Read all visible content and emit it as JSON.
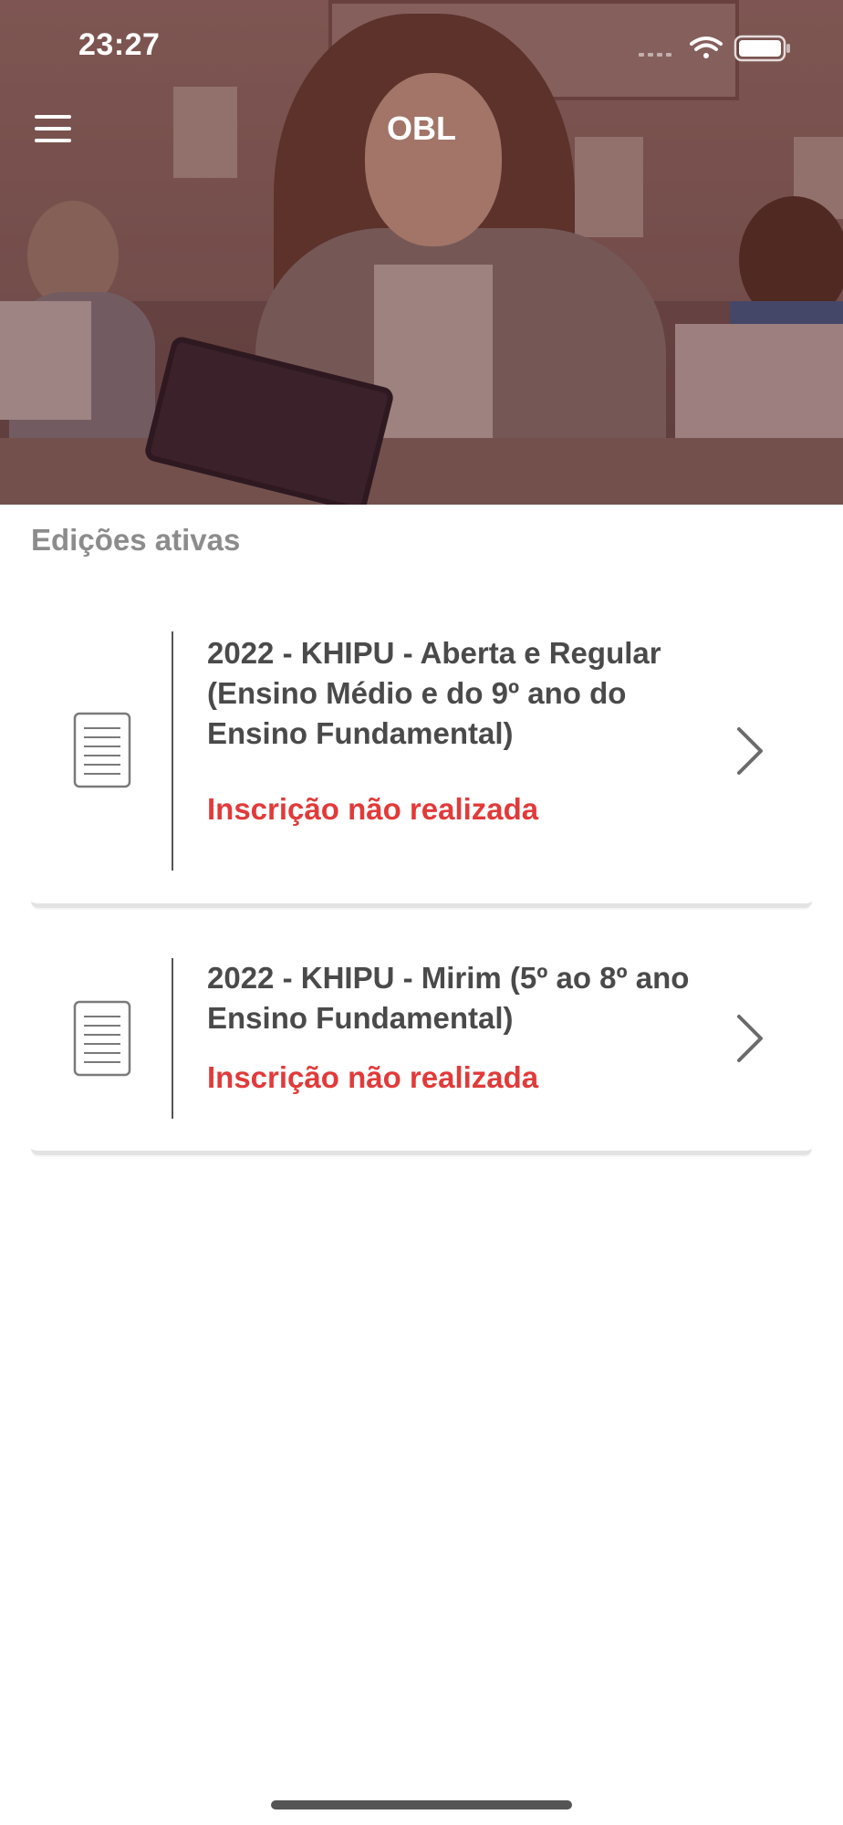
{
  "status_bar": {
    "time": "23:27",
    "icons": [
      "signal-icon",
      "wifi-icon",
      "battery-icon"
    ]
  },
  "header": {
    "title": "OBL",
    "menu_icon": "hamburger-menu-icon"
  },
  "section": {
    "title": "Edições ativas"
  },
  "editions": [
    {
      "title": "2022 - KHIPU - Aberta e Regular (Ensino Médio e do 9º ano do Ensino Fundamental)",
      "status": "Inscrição não realizada",
      "icon": "document-icon"
    },
    {
      "title": "2022 - KHIPU - Mirim (5º ao 8º ano Ensino Fundamental)",
      "status": "Inscrição não realizada",
      "icon": "document-icon"
    }
  ],
  "colors": {
    "status_red": "#e23a3a",
    "title_gray": "#4a4a4a",
    "section_gray": "#8c8c8c"
  }
}
